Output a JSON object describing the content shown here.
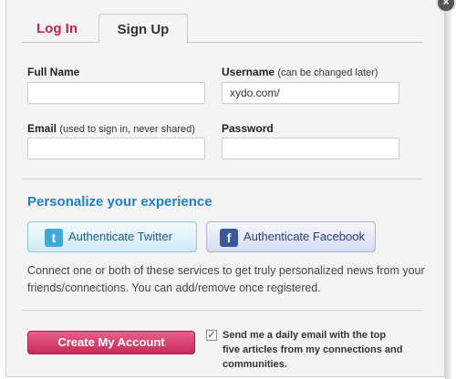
{
  "tabs": {
    "login": "Log In",
    "signup": "Sign Up"
  },
  "form": {
    "full_name": {
      "label": "Full Name",
      "value": ""
    },
    "username": {
      "label": "Username",
      "note": "(can be changed later)",
      "value": "xydo.com/"
    },
    "email": {
      "label": "Email",
      "note": "(used to sign in, never shared)",
      "value": ""
    },
    "password": {
      "label": "Password",
      "value": ""
    }
  },
  "personalize": {
    "title": "Personalize your experience",
    "twitter_label": "Authenticate Twitter",
    "facebook_label": "Authenticate Facebook",
    "description": "Connect one or both of these services to get truly personalized news from your friends/connections. You can add/remove once registered."
  },
  "footer": {
    "create_label": "Create My Account",
    "daily_email": {
      "checked": true,
      "label": "Send me a daily email with the top five articles from my connections and communities."
    }
  },
  "icons": {
    "twitter": "twitter-icon",
    "facebook": "facebook-icon",
    "close": "close-icon",
    "check": "checkmark-icon"
  },
  "colors": {
    "accent_pink": "#d02050",
    "link_blue": "#1f7fc4",
    "create_button": "#d63a6a"
  }
}
